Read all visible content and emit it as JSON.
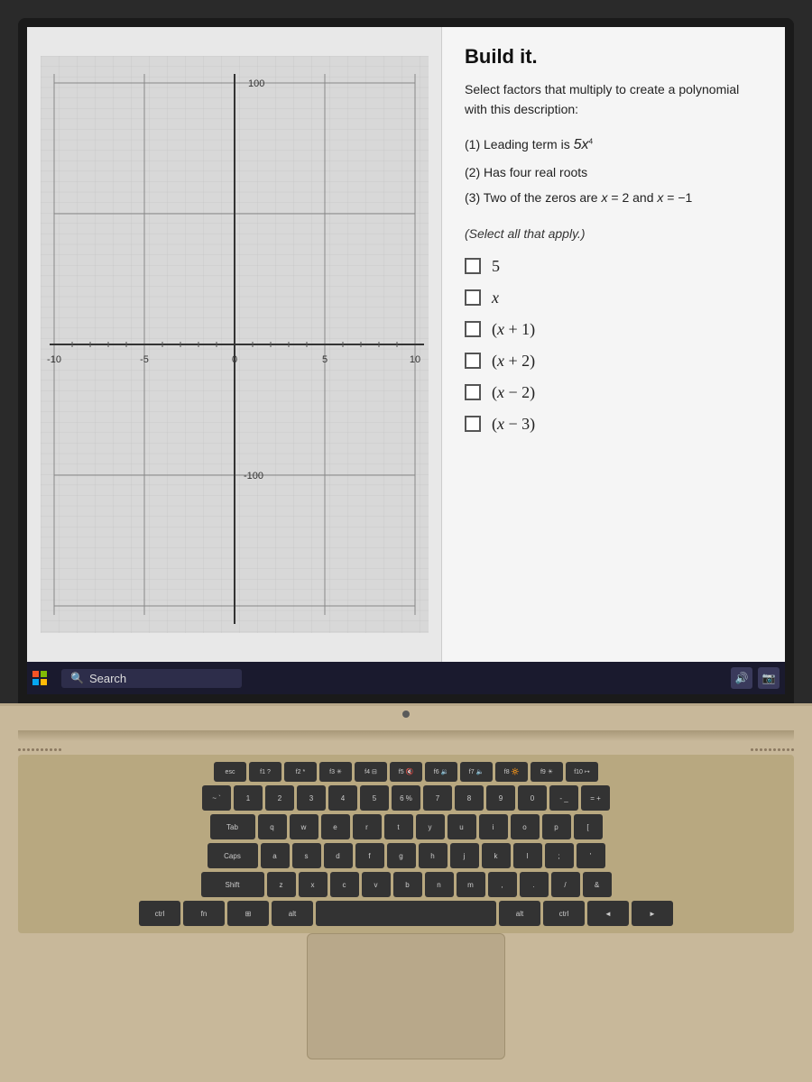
{
  "screen": {
    "title": "Build it.",
    "description": {
      "intro": "Select factors that multiply to create a polynomial with this description:",
      "conditions": [
        "(1) Leading term is 5x⁴",
        "(2) Has four real roots",
        "(3) Two of the zeros are x = 2 and x = −1"
      ]
    },
    "select_label": "(Select all that apply.)",
    "options": [
      {
        "id": "opt1",
        "label": "5",
        "math": false
      },
      {
        "id": "opt2",
        "label": "x",
        "math": true
      },
      {
        "id": "opt3",
        "label": "(x + 1)",
        "math": true
      },
      {
        "id": "opt4",
        "label": "(x + 2)",
        "math": true
      },
      {
        "id": "opt5",
        "label": "(x − 2)",
        "math": true
      },
      {
        "id": "opt6",
        "label": "(x − 3)",
        "math": true
      }
    ],
    "graph": {
      "x_min": -10,
      "x_max": 10,
      "y_min": -100,
      "y_max": 100,
      "x_labels": [
        "-10",
        "-5",
        "0",
        "5",
        "10"
      ],
      "y_labels": [
        "100",
        "-100"
      ]
    }
  },
  "taskbar": {
    "search_placeholder": "Search",
    "search_icon": "🔍"
  },
  "keyboard": {
    "fn_keys": [
      "esc",
      "f1",
      "f2",
      "f3",
      "f4",
      "f5",
      "f6",
      "f7",
      "f8",
      "f9",
      "f10"
    ],
    "rows": [
      [
        "~",
        "1",
        "2",
        "3",
        "4",
        "5",
        "6",
        "7",
        "8",
        "9",
        "0",
        "-",
        "="
      ],
      [
        "Tab",
        "q",
        "w",
        "e",
        "r",
        "t",
        "y",
        "u",
        "i",
        "o",
        "p"
      ],
      [
        "Caps",
        "a",
        "s",
        "d",
        "f",
        "g",
        "h",
        "j",
        "k",
        "l",
        ";"
      ],
      [
        "Shift",
        "z",
        "x",
        "c",
        "v",
        "b",
        "n",
        "m",
        ",",
        ".",
        "/"
      ]
    ]
  }
}
